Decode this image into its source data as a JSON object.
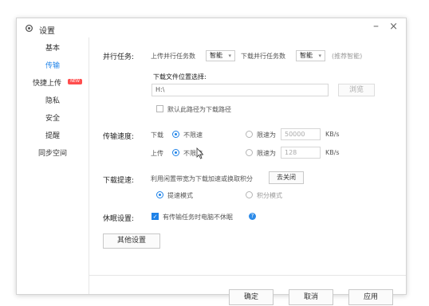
{
  "window": {
    "title": "设置",
    "minimize": "–",
    "close": "×"
  },
  "sidebar": {
    "items": [
      {
        "label": "基本"
      },
      {
        "label": "传输",
        "active": true
      },
      {
        "label": "快捷上传",
        "badge": "NEW"
      },
      {
        "label": "隐私"
      },
      {
        "label": "安全"
      },
      {
        "label": "提醒"
      },
      {
        "label": "同步空间"
      }
    ]
  },
  "parallel": {
    "label": "并行任务:",
    "upload_label": "上传并行任务数",
    "upload_value": "智能",
    "download_label": "下载并行任务数",
    "download_value": "智能",
    "hint": "(推荐智能)"
  },
  "download_path": {
    "label": "下载文件位置选择:",
    "value": "H:\\",
    "browse": "浏览",
    "default_checkbox": "默认此路径为下载路径",
    "default_checked": false
  },
  "speed": {
    "label": "传输速度:",
    "download": {
      "label": "下载",
      "unlimited": "不限速",
      "limit": "限速为",
      "value": "50000",
      "unit": "KB/s",
      "selected": "unlimited"
    },
    "upload": {
      "label": "上传",
      "unlimited": "不限速",
      "limit": "限速为",
      "value": "128",
      "unit": "KB/s",
      "selected": "unlimited"
    }
  },
  "boost": {
    "label": "下载提速:",
    "desc": "利用闲置带宽为下载加速或换取积分",
    "toggle_button": "去关闭",
    "mode_speed": "提速模式",
    "mode_points": "积分模式",
    "selected": "speed"
  },
  "sleep": {
    "label": "休眠设置:",
    "checkbox": "有传输任务时电脑不休眠",
    "checked": true
  },
  "other_settings": "其他设置",
  "footer": {
    "ok": "确定",
    "cancel": "取消",
    "apply": "应用"
  },
  "colors": {
    "accent": "#1e82e8",
    "badge": "#ff4d4d"
  }
}
